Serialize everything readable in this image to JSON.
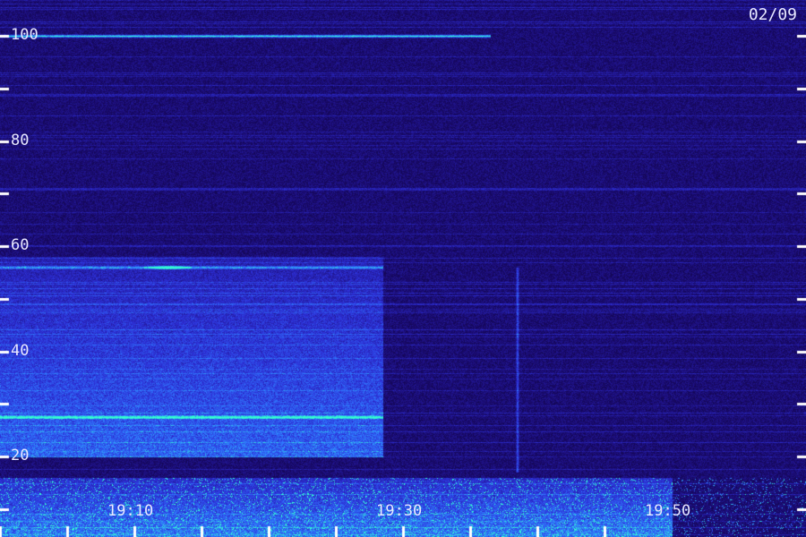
{
  "chart_data": {
    "type": "heatmap",
    "date_label": "02/09",
    "y_range": [
      0,
      110
    ],
    "x_range_minutes": [
      1130,
      1190
    ],
    "y_ticks": [
      20,
      40,
      60,
      80,
      100
    ],
    "y_tick_labels": [
      "20",
      "40",
      "60",
      "80",
      "100"
    ],
    "x_ticks_minutes": [
      1150,
      1170,
      1190
    ],
    "x_tick_labels": [
      "19:10",
      "19:30",
      "19:50"
    ],
    "minor_y_step": 10,
    "minor_x_step_minutes": 5,
    "colormap": [
      "#000010",
      "#1a0a6e",
      "#2d2fd6",
      "#2f7bff",
      "#33ffd0"
    ],
    "features": [
      {
        "kind": "horizontal-line",
        "y": 100,
        "x_end_minutes": 1176.5,
        "intensity": 0.85
      },
      {
        "kind": "horizontal-line",
        "y": 27.5,
        "x_end_minutes": 1168.5,
        "intensity": 0.75
      },
      {
        "kind": "horizontal-line",
        "y": 56,
        "x_end_minutes": 1168.5,
        "intensity": 0.55
      },
      {
        "kind": "blob",
        "x_minutes": 1152.5,
        "y": 56,
        "intensity": 0.8
      },
      {
        "kind": "band",
        "y_from": 20,
        "y_to": 58,
        "x_end_minutes": 1168.5,
        "intensity": 0.45
      },
      {
        "kind": "band",
        "y_from": 0,
        "y_to": 16,
        "x_end_minutes": 1190,
        "intensity": 0.65
      },
      {
        "kind": "vertical-line",
        "x_minutes": 1178.5,
        "y_from": 17,
        "y_to": 56,
        "intensity": 0.45
      }
    ]
  }
}
